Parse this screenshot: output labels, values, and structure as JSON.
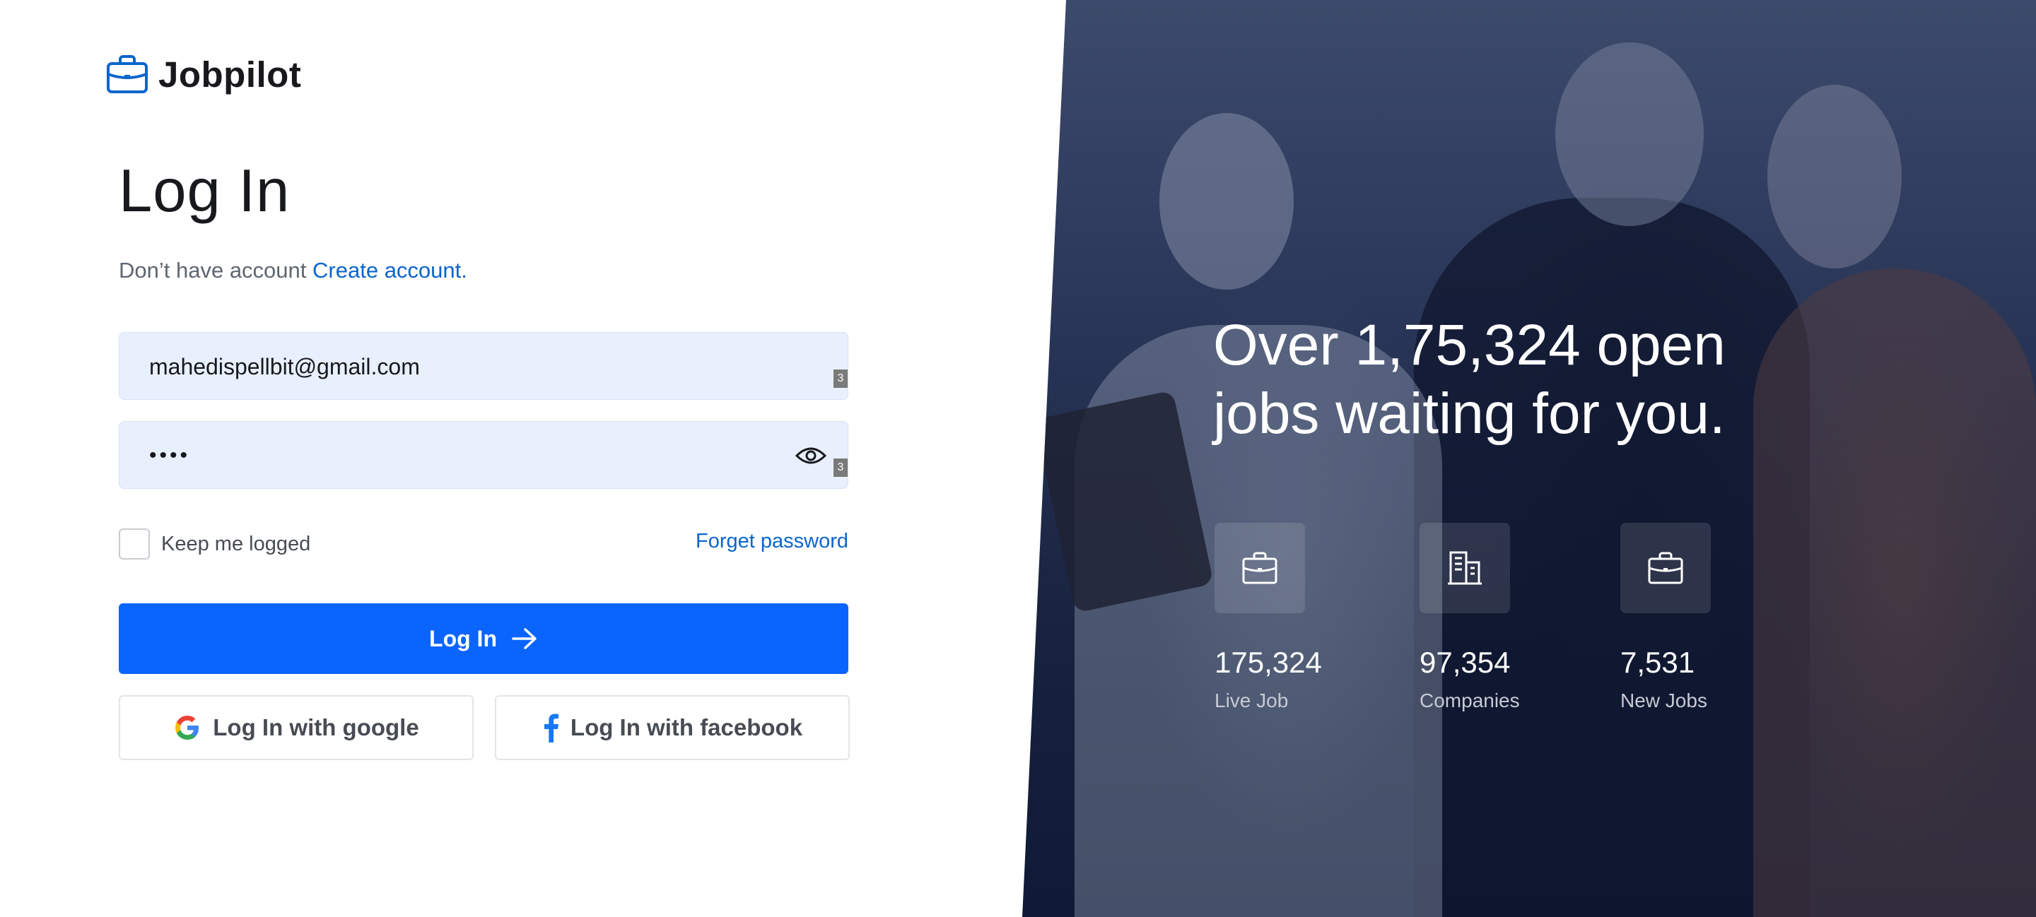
{
  "brand": {
    "name": "Jobpilot",
    "icon": "briefcase-icon",
    "accent": "#0a65cc"
  },
  "form": {
    "title": "Log In",
    "signup_prompt": "Don’t have account",
    "signup_link": "Create account.",
    "email_value": "mahedispellbit@gmail.com",
    "email_counter": "3",
    "password_value": "••••",
    "password_counter": "3",
    "keep_logged_label": "Keep me logged",
    "forget_password": "Forget password",
    "login_button": "Log In",
    "google_button": "Log In with google",
    "facebook_button": "Log In with facebook",
    "button_color": "#0a65ff",
    "field_color": "#e8f0fe"
  },
  "hero": {
    "headline": "Over 1,75,324 open jobs waiting for you.",
    "stats": [
      {
        "value": "175,324",
        "label": "Live Job",
        "icon": "briefcase-icon"
      },
      {
        "value": "97,354",
        "label": "Companies",
        "icon": "buildings-icon"
      },
      {
        "value": "7,531",
        "label": "New Jobs",
        "icon": "briefcase-icon"
      }
    ],
    "overlay_color": "#17223f"
  }
}
